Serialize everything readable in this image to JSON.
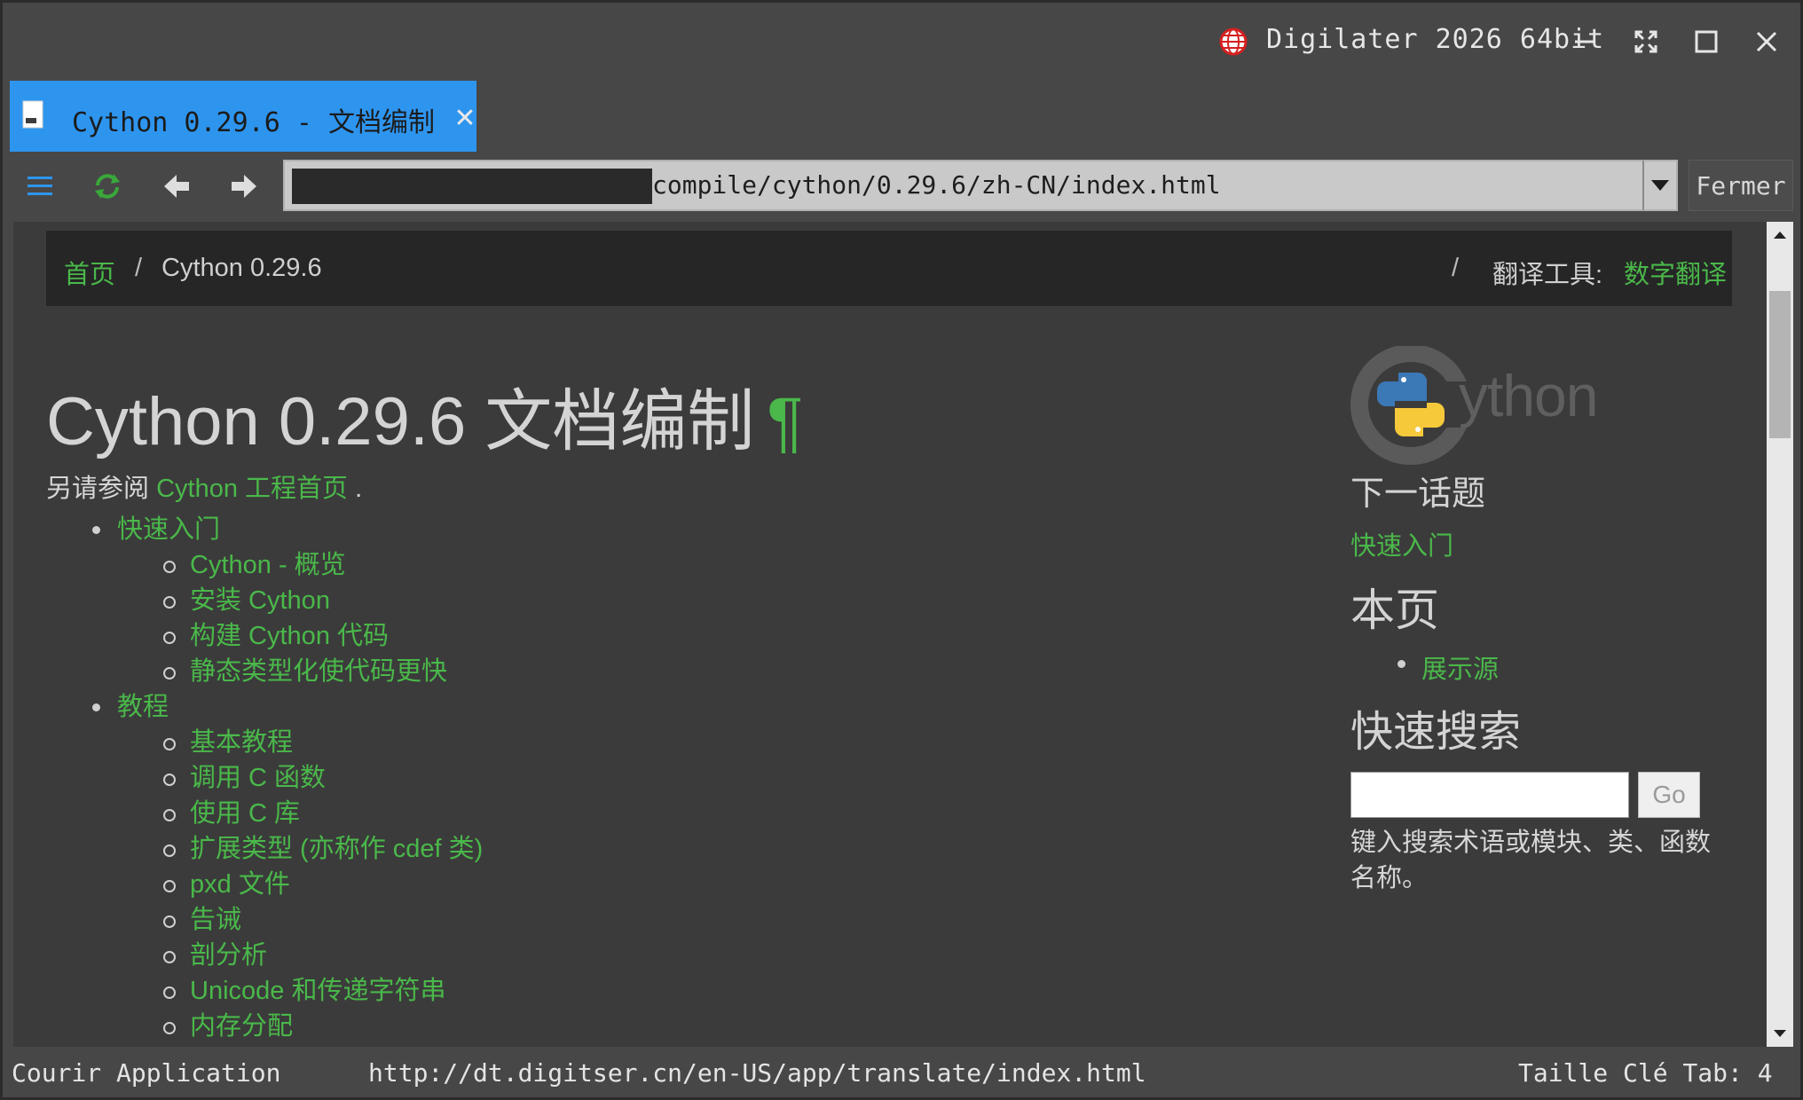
{
  "window": {
    "app_title": "Digilater 2026 64bit",
    "icons": {
      "logo": "globe-icon",
      "minimize": "minimize-icon",
      "fullscreen": "fullscreen-icon",
      "maximize": "maximize-icon",
      "close": "close-icon"
    }
  },
  "tab": {
    "label": "Cython 0.29.6 - 文档编制",
    "close_glyph": "✕"
  },
  "toolbar": {
    "address_visible": "compile/cython/0.29.6/zh-CN/index.html",
    "close_page_label": "Fermer"
  },
  "breadcrumb": {
    "home": "首页",
    "separator": "/",
    "current": "Cython 0.29.6",
    "tool_label": "翻译工具:",
    "tool_link": "数字翻译"
  },
  "main": {
    "title": "Cython 0.29.6 文档编制",
    "pilcrow": "¶",
    "see_also_prefix": "另请参阅 ",
    "see_also_link": "Cython 工程首页",
    "see_also_suffix": " .",
    "toc": [
      {
        "label": "快速入门",
        "children": [
          "Cython - 概览",
          "安装 Cython",
          "构建 Cython 代码",
          "静态类型化使代码更快"
        ]
      },
      {
        "label": "教程",
        "children": [
          "基本教程",
          "调用 C 函数",
          "使用 C 库",
          "扩展类型 (亦称作 cdef 类)",
          "pxd 文件",
          "告诫",
          "剖分析",
          "Unicode 和传递字符串",
          "内存分配"
        ]
      }
    ]
  },
  "sidebar": {
    "logo_text": "ython",
    "next_topic_heading": "下一话题",
    "next_topic_link": "快速入门",
    "this_page_heading": "本页",
    "show_source": "展示源",
    "quick_search_heading": "快速搜索",
    "search_value": "",
    "go_label": "Go",
    "search_hint": "键入搜索术语或模块、类、函数名称。"
  },
  "statusbar": {
    "left": "Courir Application",
    "url": "http://dt.digitser.cn/en-US/app/translate/index.html",
    "right": "Taille Clé Tab: 4"
  },
  "colors": {
    "accent_tab": "#2e95ef",
    "link_green": "#4ab84a",
    "breadcrumb_bg": "#262626",
    "page_bg": "#3b3b3b"
  }
}
